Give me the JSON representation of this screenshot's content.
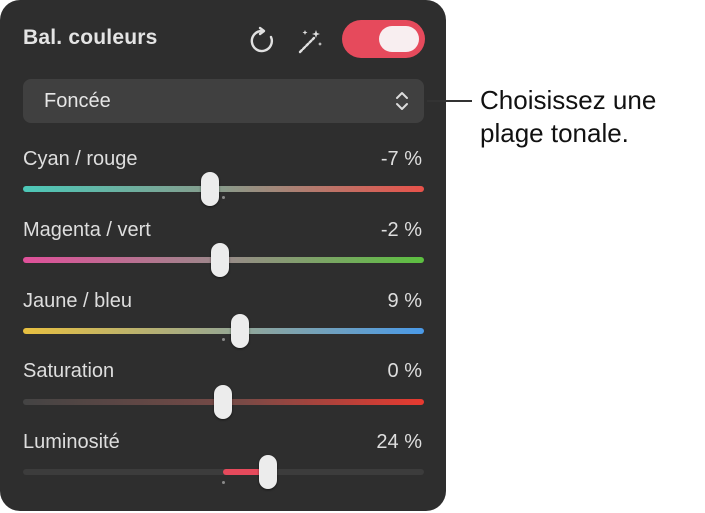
{
  "panel": {
    "title": "Bal. couleurs",
    "toggle_on": true,
    "icons": [
      "reset-icon",
      "magic-wand-icon"
    ]
  },
  "dropdown": {
    "value": "Foncée"
  },
  "sliders": [
    {
      "label": "Cyan / rouge",
      "value_text": "-7 %",
      "value": -7
    },
    {
      "label": "Magenta / vert",
      "value_text": "-2 %",
      "value": -2
    },
    {
      "label": "Jaune / bleu",
      "value_text": "9 %",
      "value": 9
    },
    {
      "label": "Saturation",
      "value_text": "0 %",
      "value": 0
    },
    {
      "label": "Luminosité",
      "value_text": "24 %",
      "value": 24
    }
  ],
  "callout": {
    "line1": "Choisissez une",
    "line2": "plage tonale."
  },
  "colors": {
    "panel_bg": "#2e2e2e",
    "accent": "#e64a5c"
  }
}
